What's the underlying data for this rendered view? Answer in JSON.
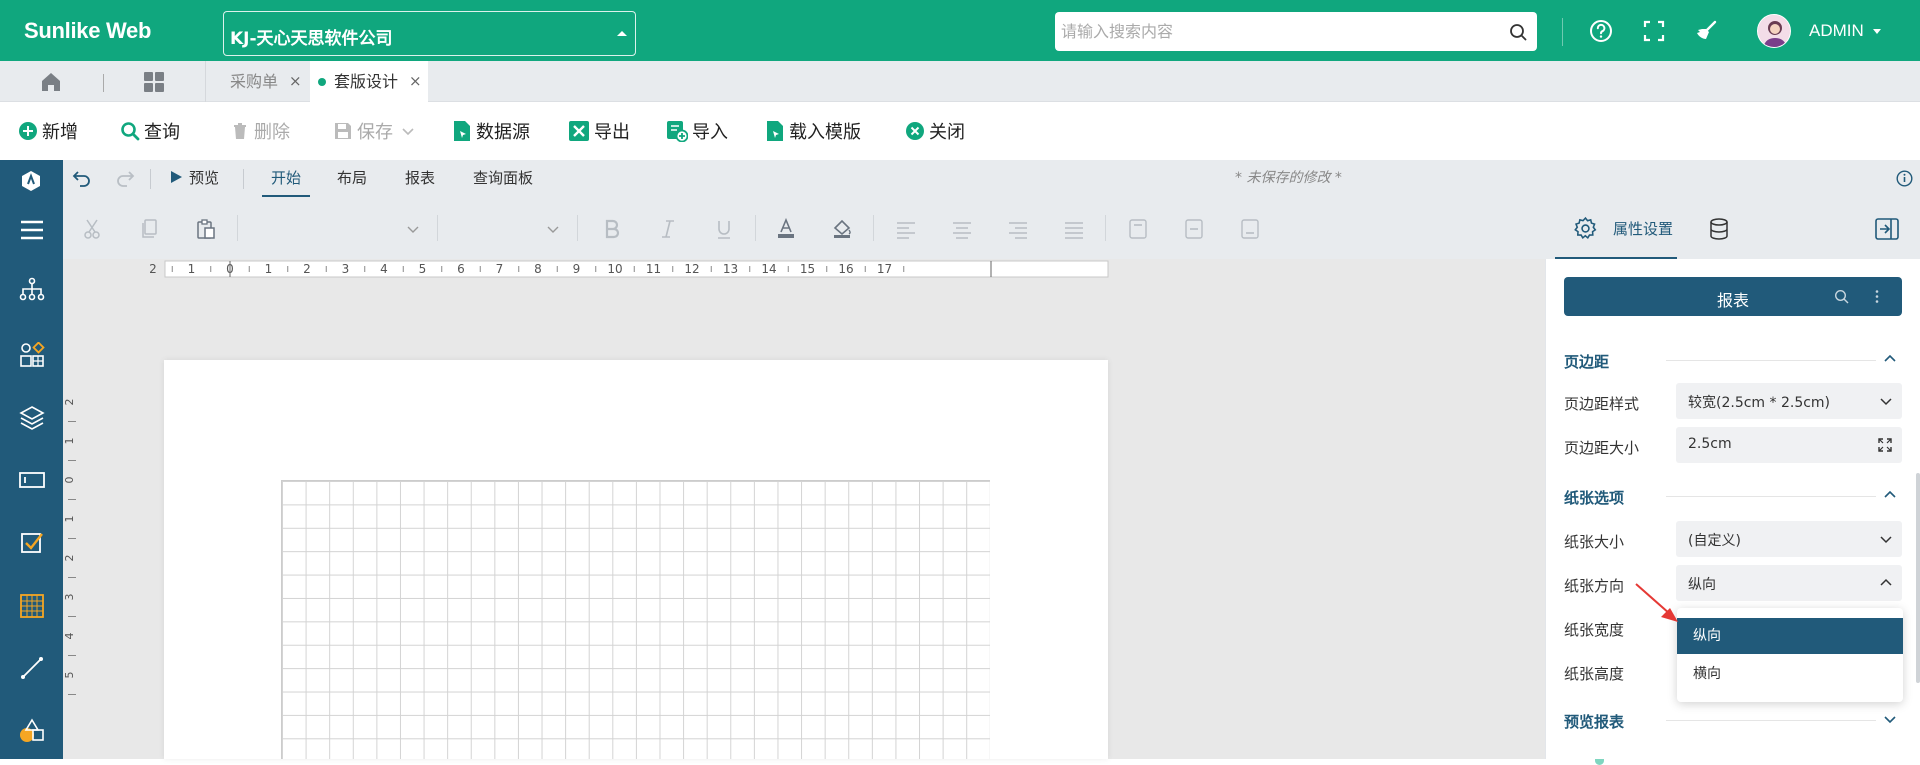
{
  "header": {
    "brand": "Sunlike Web",
    "company": "KJ-天心天思软件公司",
    "search_placeholder": "请输入搜索内容",
    "user": "ADMIN"
  },
  "tabs": {
    "items": [
      {
        "label": "采购单",
        "active": false
      },
      {
        "label": "套版设计",
        "active": true
      }
    ],
    "close_glyph": "×"
  },
  "toolbar": {
    "new": "新增",
    "query": "查询",
    "delete": "删除",
    "save": "保存",
    "datasource": "数据源",
    "export": "导出",
    "import": "导入",
    "load_template": "载入模版",
    "close": "关闭"
  },
  "designer": {
    "preview": "预览",
    "tabs": [
      "开始",
      "布局",
      "报表",
      "查询面板"
    ],
    "active_tab": "开始",
    "unsaved": "* 未保存的修改 *"
  },
  "ruler": {
    "h_ticks": [
      "2",
      "1",
      "0",
      "1",
      "2",
      "3",
      "4",
      "5",
      "6",
      "7",
      "8",
      "9",
      "10",
      "11",
      "12",
      "13",
      "14",
      "15",
      "16",
      "17"
    ],
    "v_ticks": [
      "2",
      "1",
      "0",
      "1",
      "2",
      "3",
      "4",
      "5"
    ]
  },
  "panel": {
    "tab_label": "属性设置",
    "report_title": "报表",
    "sections": {
      "margin": "页边距",
      "paper": "纸张选项",
      "preview": "预览报表"
    },
    "props": {
      "margin_style_label": "页边距样式",
      "margin_style_value": "较宽(2.5cm * 2.5cm)",
      "margin_size_label": "页边距大小",
      "margin_size_value": "2.5cm",
      "paper_size_label": "纸张大小",
      "paper_size_value": "(自定义)",
      "paper_orient_label": "纸张方向",
      "paper_orient_value": "纵向",
      "paper_width_label": "纸张宽度",
      "paper_height_label": "纸张高度"
    },
    "orientation_options": [
      "纵向",
      "横向"
    ],
    "orientation_selected": "纵向"
  },
  "colors": {
    "brand_green": "#10a77e",
    "navy": "#215a7a",
    "toolbar_bg": "#e8ebee"
  }
}
